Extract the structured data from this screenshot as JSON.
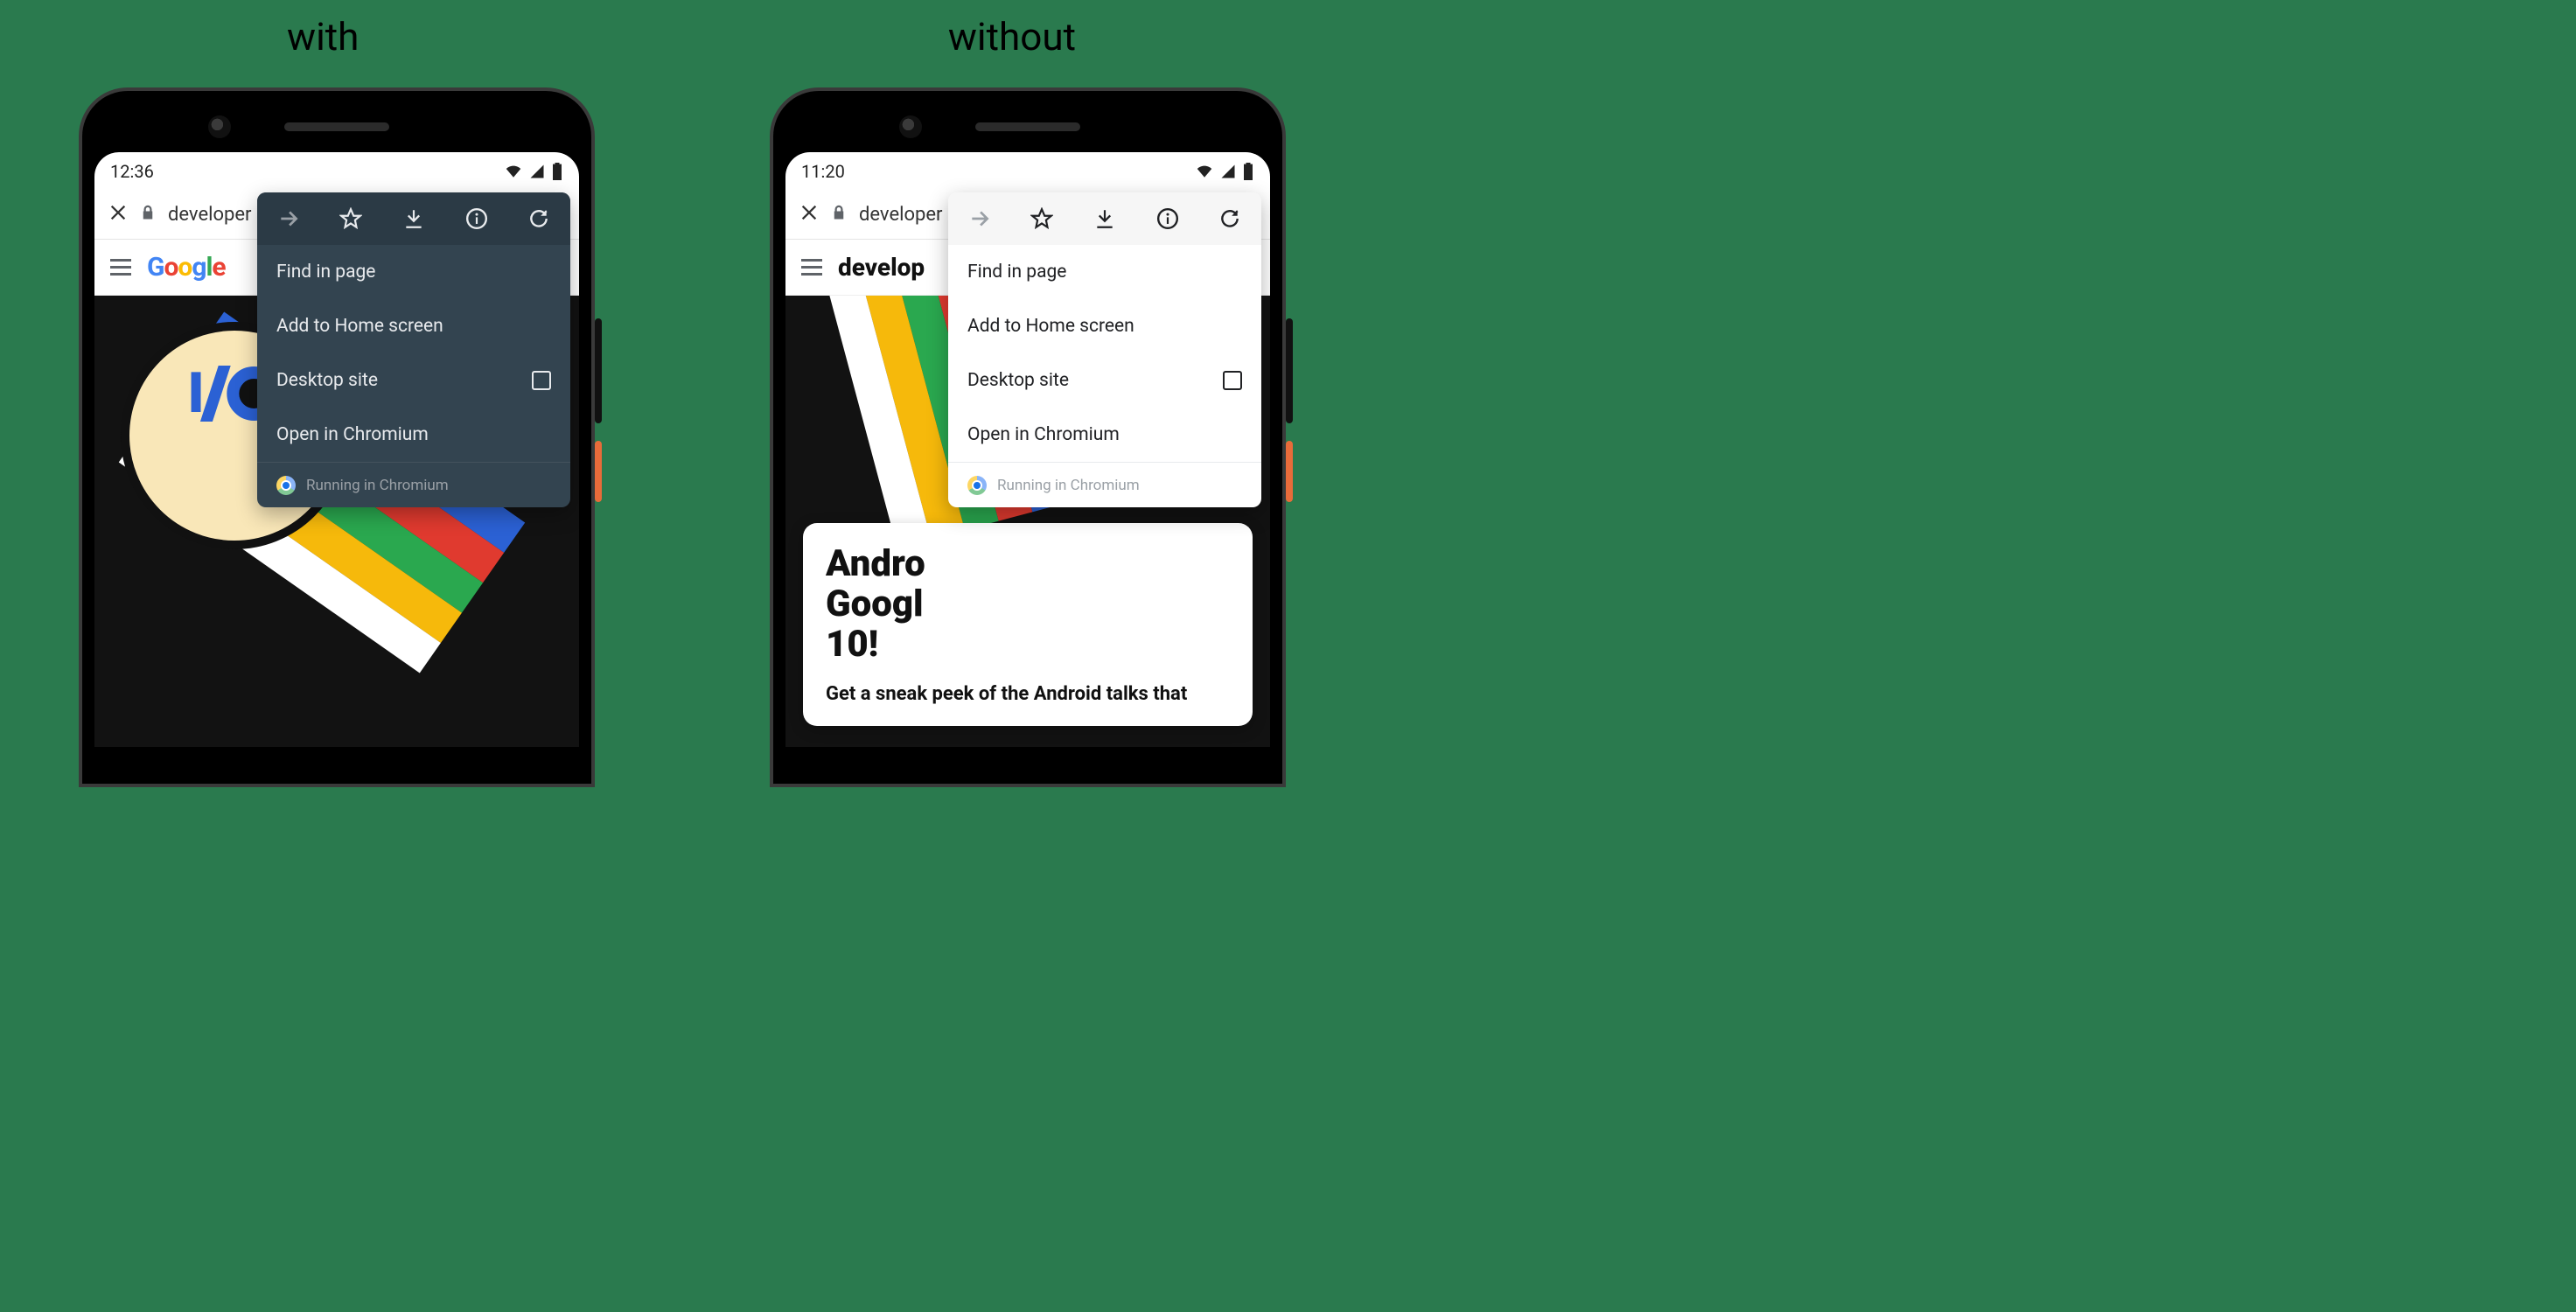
{
  "labels": {
    "left": "with",
    "right": "without"
  },
  "status": {
    "left_time": "12:36",
    "right_time": "11:20"
  },
  "urlbar": {
    "host": "developer"
  },
  "siteheader": {
    "right_brand": "develop"
  },
  "card": {
    "title_line1": "Andro",
    "title_line2": "Googl",
    "title_line3": "10!",
    "subtitle": "Get a sneak peek of the Android talks that"
  },
  "menu": {
    "find": "Find in page",
    "add": "Add to Home screen",
    "desktop": "Desktop site",
    "open": "Open in Chromium",
    "footer": "Running in Chromium"
  }
}
